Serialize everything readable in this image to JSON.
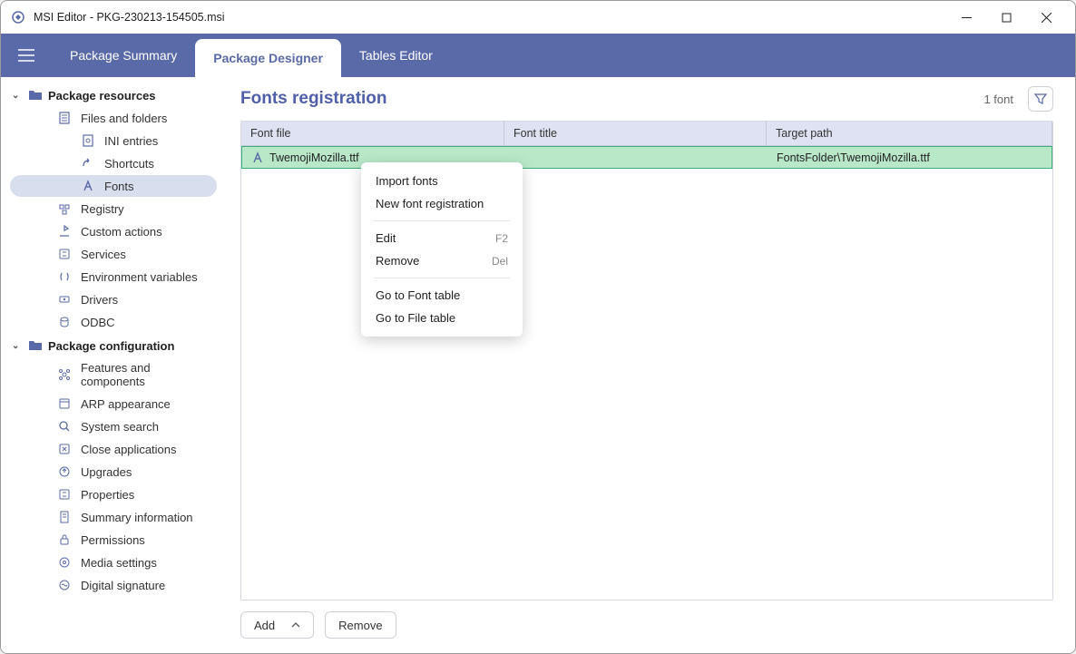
{
  "window": {
    "title": "MSI Editor - PKG-230213-154505.msi"
  },
  "tabs": [
    {
      "label": "Package Summary"
    },
    {
      "label": "Package Designer"
    },
    {
      "label": "Tables Editor"
    }
  ],
  "sidebar": {
    "groups": [
      {
        "label": "Package resources",
        "items": [
          {
            "label": "Files and folders",
            "icon": "file"
          },
          {
            "label": "INI entries",
            "icon": "ini",
            "nested": true
          },
          {
            "label": "Shortcuts",
            "icon": "shortcut",
            "nested": true
          },
          {
            "label": "Fonts",
            "icon": "font",
            "nested": true,
            "selected": true
          },
          {
            "label": "Registry",
            "icon": "registry"
          },
          {
            "label": "Custom actions",
            "icon": "action"
          },
          {
            "label": "Services",
            "icon": "services"
          },
          {
            "label": "Environment variables",
            "icon": "env"
          },
          {
            "label": "Drivers",
            "icon": "drivers"
          },
          {
            "label": "ODBC",
            "icon": "odbc"
          }
        ]
      },
      {
        "label": "Package configuration",
        "items": [
          {
            "label": "Features and components",
            "icon": "features"
          },
          {
            "label": "ARP appearance",
            "icon": "arp"
          },
          {
            "label": "System search",
            "icon": "search"
          },
          {
            "label": "Close applications",
            "icon": "close"
          },
          {
            "label": "Upgrades",
            "icon": "upgrades"
          },
          {
            "label": "Properties",
            "icon": "properties"
          },
          {
            "label": "Summary information",
            "icon": "summary"
          },
          {
            "label": "Permissions",
            "icon": "permissions"
          },
          {
            "label": "Media settings",
            "icon": "media"
          },
          {
            "label": "Digital signature",
            "icon": "signature"
          }
        ]
      }
    ]
  },
  "main": {
    "title": "Fonts registration",
    "count": "1 font",
    "columns": [
      "Font file",
      "Font title",
      "Target path"
    ],
    "rows": [
      {
        "file": "TwemojiMozilla.ttf",
        "title": "",
        "path": "FontsFolder\\TwemojiMozilla.ttf"
      }
    ],
    "add_label": "Add",
    "remove_label": "Remove"
  },
  "context_menu": {
    "items": [
      {
        "label": "Import fonts"
      },
      {
        "label": "New font registration"
      },
      {
        "sep": true
      },
      {
        "label": "Edit",
        "shortcut": "F2"
      },
      {
        "label": "Remove",
        "shortcut": "Del"
      },
      {
        "sep": true
      },
      {
        "label": "Go to Font table"
      },
      {
        "label": "Go to File table"
      }
    ]
  }
}
